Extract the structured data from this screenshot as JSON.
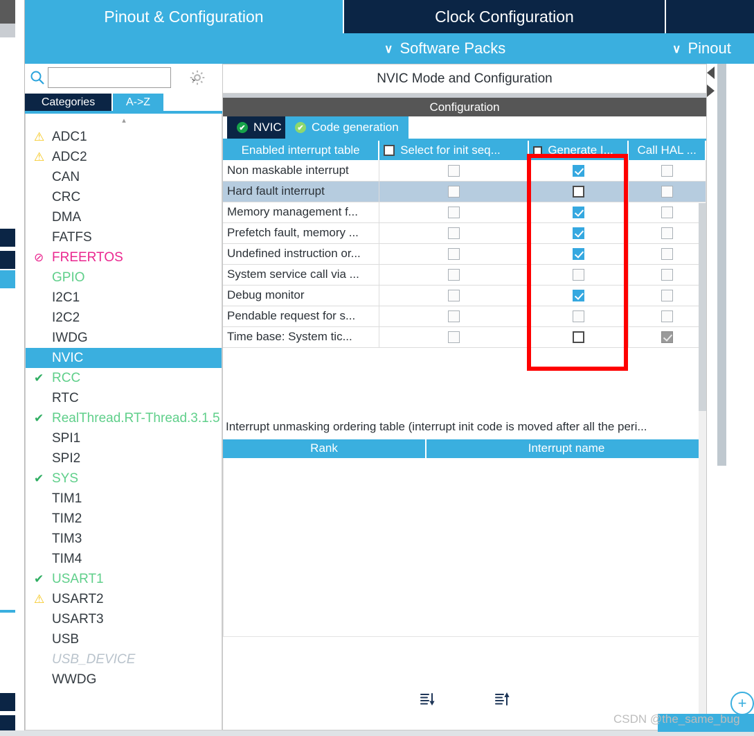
{
  "top_tabs": [
    {
      "label": "Pinout & Configuration",
      "state": "light"
    },
    {
      "label": "Clock Configuration",
      "state": "dark"
    },
    {
      "label": "",
      "state": "dark"
    }
  ],
  "subbar": {
    "software_packs": "Software Packs",
    "pinout": "Pinout",
    "chevron": "∨"
  },
  "sidebar": {
    "search": {
      "value": "",
      "placeholder": "",
      "icon": "search-icon",
      "caret": "⌄"
    },
    "gear": "gear-icon",
    "tabs": [
      {
        "label": "Categories",
        "active": false
      },
      {
        "label": "A->Z",
        "active": true
      }
    ],
    "items": [
      {
        "label": "ADC1",
        "status": "warning",
        "badge": "⚠"
      },
      {
        "label": "ADC2",
        "status": "warning",
        "badge": "⚠"
      },
      {
        "label": "CAN",
        "status": "none",
        "badge": ""
      },
      {
        "label": "CRC",
        "status": "none",
        "badge": ""
      },
      {
        "label": "DMA",
        "status": "none",
        "badge": ""
      },
      {
        "label": "FATFS",
        "status": "none",
        "badge": ""
      },
      {
        "label": "FREERTOS",
        "status": "blocked",
        "badge": "⊘"
      },
      {
        "label": "GPIO",
        "status": "ok-nomark",
        "badge": ""
      },
      {
        "label": "I2C1",
        "status": "none",
        "badge": ""
      },
      {
        "label": "I2C2",
        "status": "none",
        "badge": ""
      },
      {
        "label": "IWDG",
        "status": "none",
        "badge": ""
      },
      {
        "label": "NVIC",
        "status": "selected",
        "badge": ""
      },
      {
        "label": "RCC",
        "status": "ok",
        "badge": "✔"
      },
      {
        "label": "RTC",
        "status": "none",
        "badge": ""
      },
      {
        "label": "RealThread.RT-Thread.3.1.5",
        "status": "ok",
        "badge": "✔"
      },
      {
        "label": "SPI1",
        "status": "none",
        "badge": ""
      },
      {
        "label": "SPI2",
        "status": "none",
        "badge": ""
      },
      {
        "label": "SYS",
        "status": "ok",
        "badge": "✔"
      },
      {
        "label": "TIM1",
        "status": "none",
        "badge": ""
      },
      {
        "label": "TIM2",
        "status": "none",
        "badge": ""
      },
      {
        "label": "TIM3",
        "status": "none",
        "badge": ""
      },
      {
        "label": "TIM4",
        "status": "none",
        "badge": ""
      },
      {
        "label": "USART1",
        "status": "ok",
        "badge": "✔"
      },
      {
        "label": "USART2",
        "status": "warning",
        "badge": "⚠"
      },
      {
        "label": "USART3",
        "status": "none",
        "badge": ""
      },
      {
        "label": "USB",
        "status": "none",
        "badge": ""
      },
      {
        "label": "USB_DEVICE",
        "status": "grayed",
        "badge": ""
      },
      {
        "label": "WWDG",
        "status": "none",
        "badge": ""
      }
    ]
  },
  "main": {
    "mode_title": "NVIC Mode and Configuration",
    "config_header": "Configuration",
    "inner_tabs": [
      {
        "label": "NVIC",
        "active": true,
        "badge": "✔"
      },
      {
        "label": "Code generation",
        "active": false,
        "badge": "✔"
      }
    ],
    "interrupt_table": {
      "columns": [
        "Enabled interrupt table",
        "Select for init seq...",
        "Generate I...",
        "Call HAL ..."
      ],
      "rows": [
        {
          "name": "Non maskable interrupt",
          "select_init": false,
          "generate": true,
          "call_hal": false,
          "striped": false,
          "generate_style": "normal",
          "call_hal_style": "normal"
        },
        {
          "name": "Hard fault interrupt",
          "select_init": false,
          "generate": false,
          "call_hal": false,
          "striped": true,
          "generate_style": "emphasized",
          "call_hal_style": "normal"
        },
        {
          "name": "Memory management f...",
          "select_init": false,
          "generate": true,
          "call_hal": false,
          "striped": false,
          "generate_style": "normal",
          "call_hal_style": "normal"
        },
        {
          "name": "Prefetch fault, memory ...",
          "select_init": false,
          "generate": true,
          "call_hal": false,
          "striped": false,
          "generate_style": "normal",
          "call_hal_style": "normal"
        },
        {
          "name": "Undefined instruction or...",
          "select_init": false,
          "generate": true,
          "call_hal": false,
          "striped": false,
          "generate_style": "normal",
          "call_hal_style": "normal"
        },
        {
          "name": "System service call via ...",
          "select_init": false,
          "generate": false,
          "call_hal": false,
          "striped": false,
          "generate_style": "normal",
          "call_hal_style": "normal"
        },
        {
          "name": "Debug monitor",
          "select_init": false,
          "generate": true,
          "call_hal": false,
          "striped": false,
          "generate_style": "normal",
          "call_hal_style": "normal"
        },
        {
          "name": "Pendable request for s...",
          "select_init": false,
          "generate": false,
          "call_hal": false,
          "striped": false,
          "generate_style": "normal",
          "call_hal_style": "normal"
        },
        {
          "name": "Time base: System tic...",
          "select_init": false,
          "generate": false,
          "call_hal": true,
          "striped": false,
          "generate_style": "emphasized",
          "call_hal_style": "disabled"
        }
      ]
    },
    "ordering_note": "Interrupt unmasking ordering table (interrupt init code is moved after all the peri...",
    "ordering_table": {
      "columns": [
        "Rank",
        "Interrupt name"
      ],
      "rows": []
    },
    "sort_buttons": [
      {
        "name": "sort-descending-button",
        "glyph": "↓"
      },
      {
        "name": "sort-ascending-button",
        "glyph": "↑"
      }
    ]
  },
  "right_edge": {
    "collapse_left": "triangle-left-icon",
    "collapse_right": "triangle-right-icon",
    "zoom_in": "+"
  },
  "watermark": "CSDN @the_same_bug",
  "colors": {
    "accent_blue": "#3aafdf",
    "dark_navy": "#0b2545",
    "highlight_red": "#fe0000",
    "row_stripe": "#b6ccdf",
    "ok_green": "#5fcf8a",
    "warning_yellow": "#f5c518",
    "blocked_pink": "#ea268f"
  }
}
